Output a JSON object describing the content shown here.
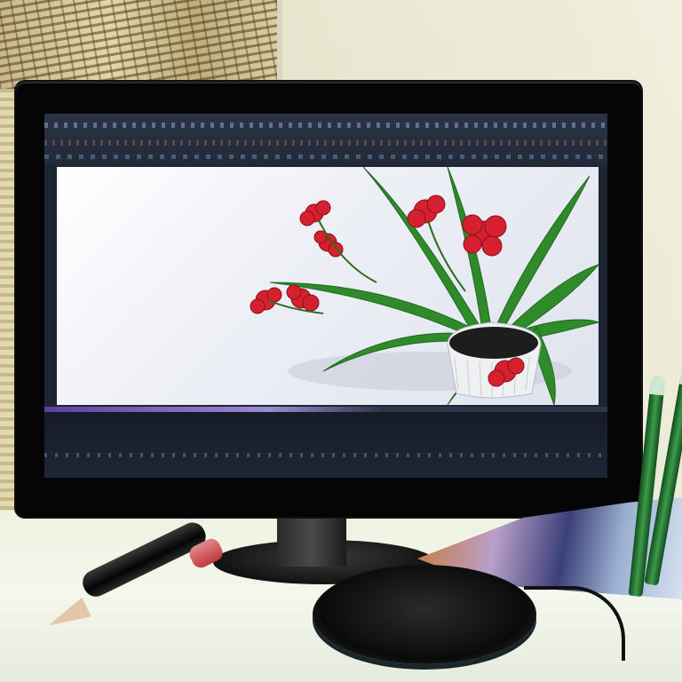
{
  "scene": {
    "description_colors": {
      "wall": "#e9e6d0",
      "desk": "#f1f5e8",
      "monitor_bezel": "#050506",
      "screen_ui": "#1e2532",
      "flower_red": "#d6202f",
      "leaf_green": "#2f8a2a"
    },
    "icons": [
      "monitor-icon",
      "flower-pot-icon",
      "pen-icon",
      "mouse-icon",
      "magazine-icon",
      "pencil-icon"
    ]
  }
}
